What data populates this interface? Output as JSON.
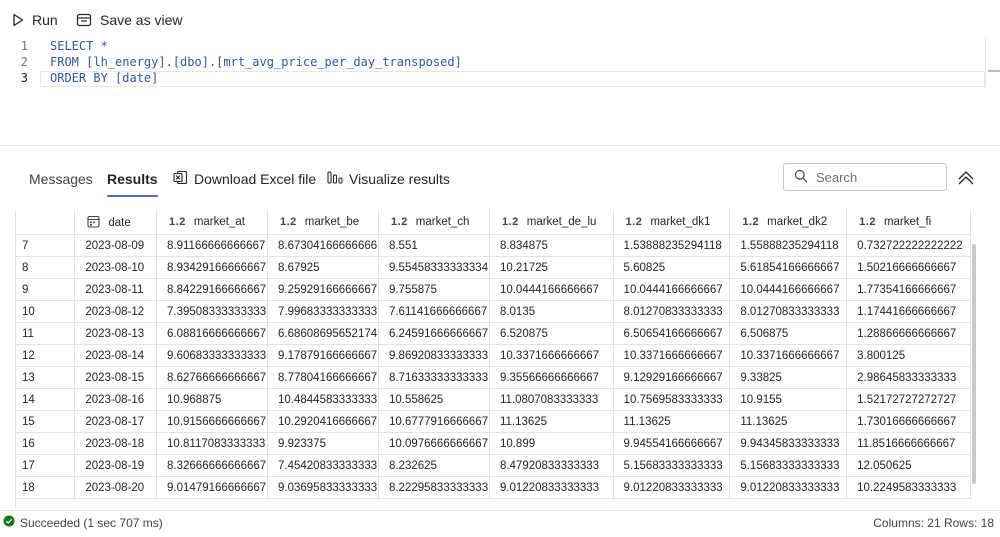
{
  "toolbar": {
    "run_label": "Run",
    "save_view_label": "Save as view"
  },
  "editor": {
    "lines": [
      {
        "number": "1",
        "code": "SELECT *"
      },
      {
        "number": "2",
        "code": "FROM [lh_energy].[dbo].[mrt_avg_price_per_day_transposed]"
      },
      {
        "number": "3",
        "code": "ORDER BY [date]"
      }
    ]
  },
  "results_panel": {
    "tabs": [
      "Messages",
      "Results"
    ],
    "active_tab": "Results",
    "download_label": "Download Excel file",
    "visualize_label": "Visualize results",
    "search_placeholder": "Search"
  },
  "grid": {
    "columns": [
      {
        "name": "date",
        "type_icon": "calendar-icon"
      },
      {
        "name": "market_at",
        "type_icon": "1.2"
      },
      {
        "name": "market_be",
        "type_icon": "1.2"
      },
      {
        "name": "market_ch",
        "type_icon": "1.2"
      },
      {
        "name": "market_de_lu",
        "type_icon": "1.2"
      },
      {
        "name": "market_dk1",
        "type_icon": "1.2"
      },
      {
        "name": "market_dk2",
        "type_icon": "1.2"
      },
      {
        "name": "market_fi",
        "type_icon": "1.2"
      }
    ],
    "rows": [
      [
        "7",
        "2023-08-09",
        "8.91166666666667",
        "8.67304166666666",
        "8.551",
        "8.834875",
        "1.53888235294118",
        "1.55888235294118",
        "0.732722222222222"
      ],
      [
        "8",
        "2023-08-10",
        "8.93429166666667",
        "8.67925",
        "9.55458333333334",
        "10.21725",
        "5.60825",
        "5.61854166666667",
        "1.50216666666667"
      ],
      [
        "9",
        "2023-08-11",
        "8.84229166666667",
        "9.25929166666667",
        "9.755875",
        "10.0444166666667",
        "10.0444166666667",
        "10.0444166666667",
        "1.77354166666667"
      ],
      [
        "10",
        "2023-08-12",
        "7.39508333333333",
        "7.99683333333333",
        "7.61141666666667",
        "8.0135",
        "8.01270833333333",
        "8.01270833333333",
        "1.17441666666667"
      ],
      [
        "11",
        "2023-08-13",
        "6.08816666666667",
        "6.68608695652174",
        "6.24591666666667",
        "6.520875",
        "6.50654166666667",
        "6.506875",
        "1.28866666666667"
      ],
      [
        "12",
        "2023-08-14",
        "9.60683333333333",
        "9.17879166666667",
        "9.86920833333333",
        "10.3371666666667",
        "10.3371666666667",
        "10.3371666666667",
        "3.800125"
      ],
      [
        "13",
        "2023-08-15",
        "8.62766666666667",
        "8.77804166666667",
        "8.71633333333333",
        "9.35566666666667",
        "9.12929166666667",
        "9.33825",
        "2.98645833333333"
      ],
      [
        "14",
        "2023-08-16",
        "10.968875",
        "10.4844583333333",
        "10.558625",
        "11.0807083333333",
        "10.7569583333333",
        "10.9155",
        "1.52172727272727"
      ],
      [
        "15",
        "2023-08-17",
        "10.9156666666667",
        "10.2920416666667",
        "10.6777916666667",
        "11.13625",
        "11.13625",
        "11.13625",
        "1.73016666666667"
      ],
      [
        "16",
        "2023-08-18",
        "10.8117083333333",
        "9.923375",
        "10.0976666666667",
        "10.899",
        "9.94554166666667",
        "9.94345833333333",
        "11.8516666666667"
      ],
      [
        "17",
        "2023-08-19",
        "8.32666666666667",
        "7.45420833333333",
        "8.232625",
        "8.47920833333333",
        "5.15683333333333",
        "5.15683333333333",
        "12.050625"
      ],
      [
        "18",
        "2023-08-20",
        "9.01479166666667",
        "9.03695833333333",
        "8.22295833333333",
        "9.01220833333333",
        "9.01220833333333",
        "9.01220833333333",
        "10.2249583333333"
      ]
    ]
  },
  "status": {
    "message": "Succeeded (1 sec 707 ms)",
    "summary": "Columns:  21  Rows:  18",
    "success_color": "#107c10"
  }
}
